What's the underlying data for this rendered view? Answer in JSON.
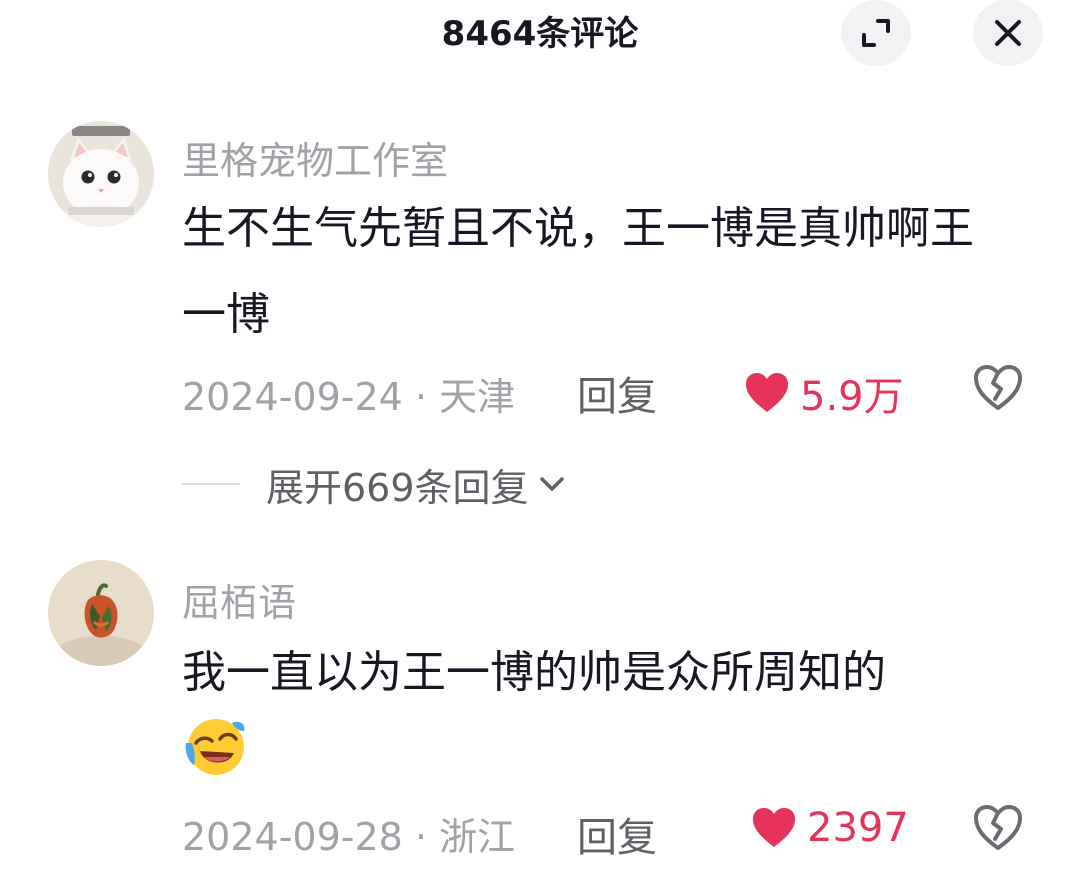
{
  "header": {
    "title": "8464条评论",
    "expand_icon": "fullscreen-exit-icon",
    "close_icon": "close-icon"
  },
  "comments": [
    {
      "username": "里格宠物工作室",
      "avatar": "white-cat-avatar",
      "content": "生不生气先暂且不说，王一博是真帅啊王一博",
      "meta": "2024-09-24 · 天津",
      "reply_label": "回复",
      "likes": "5.9万",
      "liked": true,
      "expand_replies": "展开669条回复"
    },
    {
      "username": "屈栢语",
      "avatar": "pepper-avatar",
      "content": "我一直以为王一博的帅是众所周知的",
      "emoji": "laughing-crying-emoji",
      "meta": "2024-09-28 · 浙江",
      "reply_label": "回复",
      "likes": "2397",
      "liked": true
    }
  ],
  "colors": {
    "like_red": "#e5335a",
    "secondary_text": "#a1a2a7",
    "primary_text": "#161823"
  }
}
